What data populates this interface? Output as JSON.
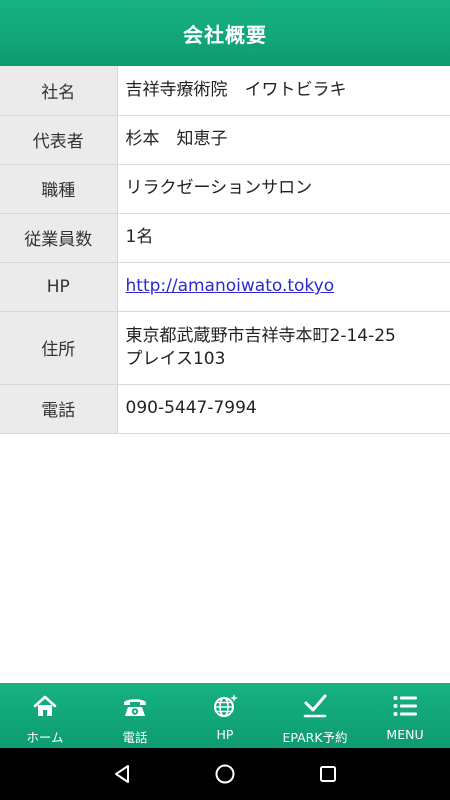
{
  "header": {
    "title": "会社概要"
  },
  "rows": [
    {
      "label": "社名",
      "value": "吉祥寺療術院　イワトビラキ"
    },
    {
      "label": "代表者",
      "value": "杉本　知恵子"
    },
    {
      "label": "職種",
      "value": "リラクゼーションサロン"
    },
    {
      "label": "従業員数",
      "value": "1名"
    },
    {
      "label": "HP",
      "value": "http://amanoiwato.tokyo"
    },
    {
      "label": "住所",
      "value_line1": "東京都武蔵野市吉祥寺本町2-14-25",
      "value_line2": "プレイス103"
    },
    {
      "label": "電話",
      "value": "090-5447-7994"
    }
  ],
  "tabbar": {
    "home": {
      "label": "ホーム",
      "icon": "home-icon"
    },
    "phone": {
      "label": "電話",
      "icon": "phone-icon"
    },
    "hp": {
      "label": "HP",
      "icon": "globe-icon"
    },
    "epark": {
      "label": "EPARK予約",
      "icon": "check-icon"
    },
    "menu": {
      "label": "MENU",
      "icon": "menu-icon"
    }
  },
  "colors": {
    "brand_green": "#10a878",
    "link": "#2a2ad0",
    "label_bg": "#ebebeb"
  }
}
